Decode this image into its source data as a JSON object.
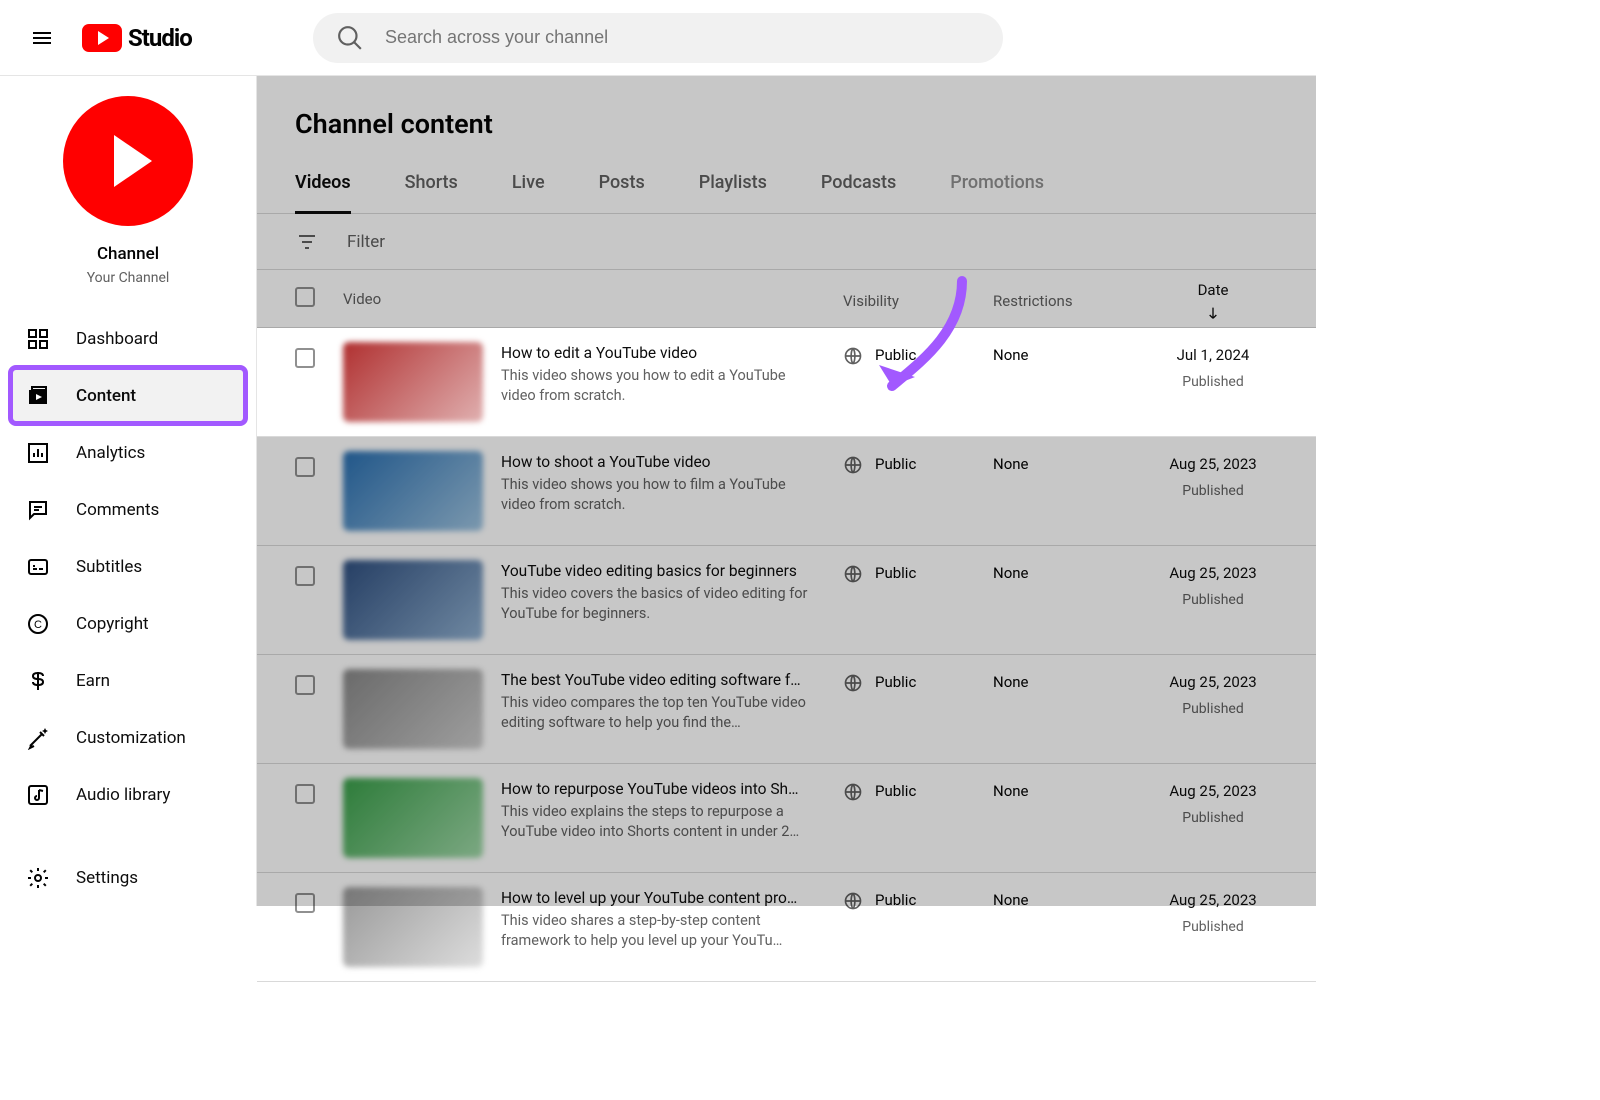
{
  "header": {
    "logo_text": "Studio",
    "search_placeholder": "Search across your channel"
  },
  "sidebar": {
    "channel_label": "Channel",
    "channel_sub": "Your Channel",
    "items": [
      {
        "label": "Dashboard"
      },
      {
        "label": "Content"
      },
      {
        "label": "Analytics"
      },
      {
        "label": "Comments"
      },
      {
        "label": "Subtitles"
      },
      {
        "label": "Copyright"
      },
      {
        "label": "Earn"
      },
      {
        "label": "Customization"
      },
      {
        "label": "Audio library"
      }
    ],
    "settings_label": "Settings"
  },
  "main": {
    "title": "Channel content",
    "tabs": [
      "Videos",
      "Shorts",
      "Live",
      "Posts",
      "Playlists",
      "Podcasts",
      "Promotions"
    ],
    "active_tab": 0,
    "filter_placeholder": "Filter",
    "columns": {
      "video": "Video",
      "visibility": "Visibility",
      "restrictions": "Restrictions",
      "date": "Date"
    },
    "rows": [
      {
        "title": "How to edit a YouTube video",
        "desc": "This video shows you how to edit a YouTube video from scratch.",
        "visibility": "Public",
        "restrictions": "None",
        "date": "Jul 1, 2024",
        "status": "Published"
      },
      {
        "title": "How to shoot a YouTube video",
        "desc": "This video shows you how to film a YouTube video from scratch.",
        "visibility": "Public",
        "restrictions": "None",
        "date": "Aug 25, 2023",
        "status": "Published"
      },
      {
        "title": "YouTube video editing basics for beginners",
        "desc": "This video covers the basics of video editing for YouTube for beginners.",
        "visibility": "Public",
        "restrictions": "None",
        "date": "Aug 25, 2023",
        "status": "Published"
      },
      {
        "title": "The best YouTube video editing software f…",
        "desc": "This video compares the top ten YouTube video editing software to help you find the…",
        "visibility": "Public",
        "restrictions": "None",
        "date": "Aug 25, 2023",
        "status": "Published"
      },
      {
        "title": "How to repurpose YouTube videos into Sh…",
        "desc": "This video explains the steps to repurpose a YouTube video into Shorts content in under 2…",
        "visibility": "Public",
        "restrictions": "None",
        "date": "Aug 25, 2023",
        "status": "Published"
      },
      {
        "title": "How to level up your YouTube content pro…",
        "desc": "This video shares a step-by-step content framework to help you level up your YouTu…",
        "visibility": "Public",
        "restrictions": "None",
        "date": "Aug 25, 2023",
        "status": "Published"
      }
    ]
  }
}
